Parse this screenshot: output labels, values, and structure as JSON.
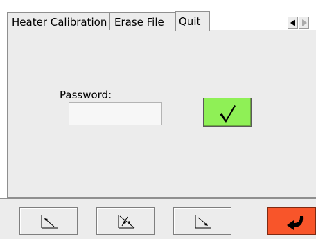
{
  "tabs": {
    "items": [
      {
        "label": "Heater Calibration",
        "active": false
      },
      {
        "label": "Erase File",
        "active": false
      },
      {
        "label": "Quit",
        "active": true
      }
    ],
    "scroll_left_icon": "arrow-left-icon",
    "scroll_right_icon": "arrow-right-icon"
  },
  "form": {
    "password_label": "Password:",
    "password_value": "",
    "confirm_icon": "checkmark-icon",
    "confirm_color": "#8ff056"
  },
  "toolbar": {
    "buttons": [
      {
        "icon": "arrow-up-left-icon"
      },
      {
        "icon": "arrows-converge-icon"
      },
      {
        "icon": "arrow-down-right-icon"
      }
    ],
    "enter_icon": "enter-return-icon",
    "enter_color": "#f8552a"
  }
}
